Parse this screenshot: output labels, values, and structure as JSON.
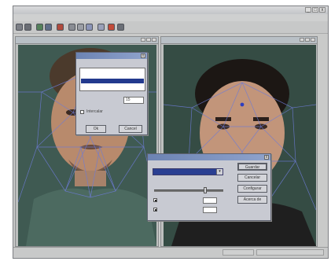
{
  "app": {
    "title": "",
    "window_buttons": [
      "_",
      "□",
      "x"
    ],
    "menu": [
      "",
      "",
      "",
      "",
      "",
      ""
    ]
  },
  "toolbar": {
    "icons": [
      "new-icon",
      "open-icon",
      "save-icon",
      "image-icon",
      "play-icon",
      "draw-icon",
      "select-icon",
      "zoom-icon",
      "grid-icon",
      "color-icon",
      "export-icon"
    ]
  },
  "panes": {
    "left": {
      "title": ""
    },
    "right": {
      "title": ""
    }
  },
  "avi_dialog": {
    "title": "",
    "compressor_label": "",
    "compressor_options": [
      "",
      "",
      "",
      ""
    ],
    "selected_index": 2,
    "frames_per_second_label": "",
    "frames_per_second_value": "15",
    "interlace_label": "Intercalar",
    "ok_label": "Ok",
    "cancel_label": "Cancel"
  },
  "compression_dialog": {
    "title": "",
    "compressor_label": "",
    "compressor_value": "",
    "quality_label": "",
    "quality_value": 0.75,
    "keyframe_label": "",
    "keyframe_value": "",
    "keyframe_suffix": "",
    "datarate_label": "",
    "datarate_value": "",
    "datarate_suffix": "",
    "save_label": "Guardar",
    "cancel_label": "Cancelar",
    "configure_label": "Configurar",
    "about_label": "Acerca de"
  },
  "statusbar": {
    "cell1": "",
    "cell2": ""
  },
  "colors": {
    "photo_bg": "#3f5a52",
    "mesh": "#6d7bd6",
    "selection": "#233a8e",
    "dialog_title": "#6c83b3"
  }
}
